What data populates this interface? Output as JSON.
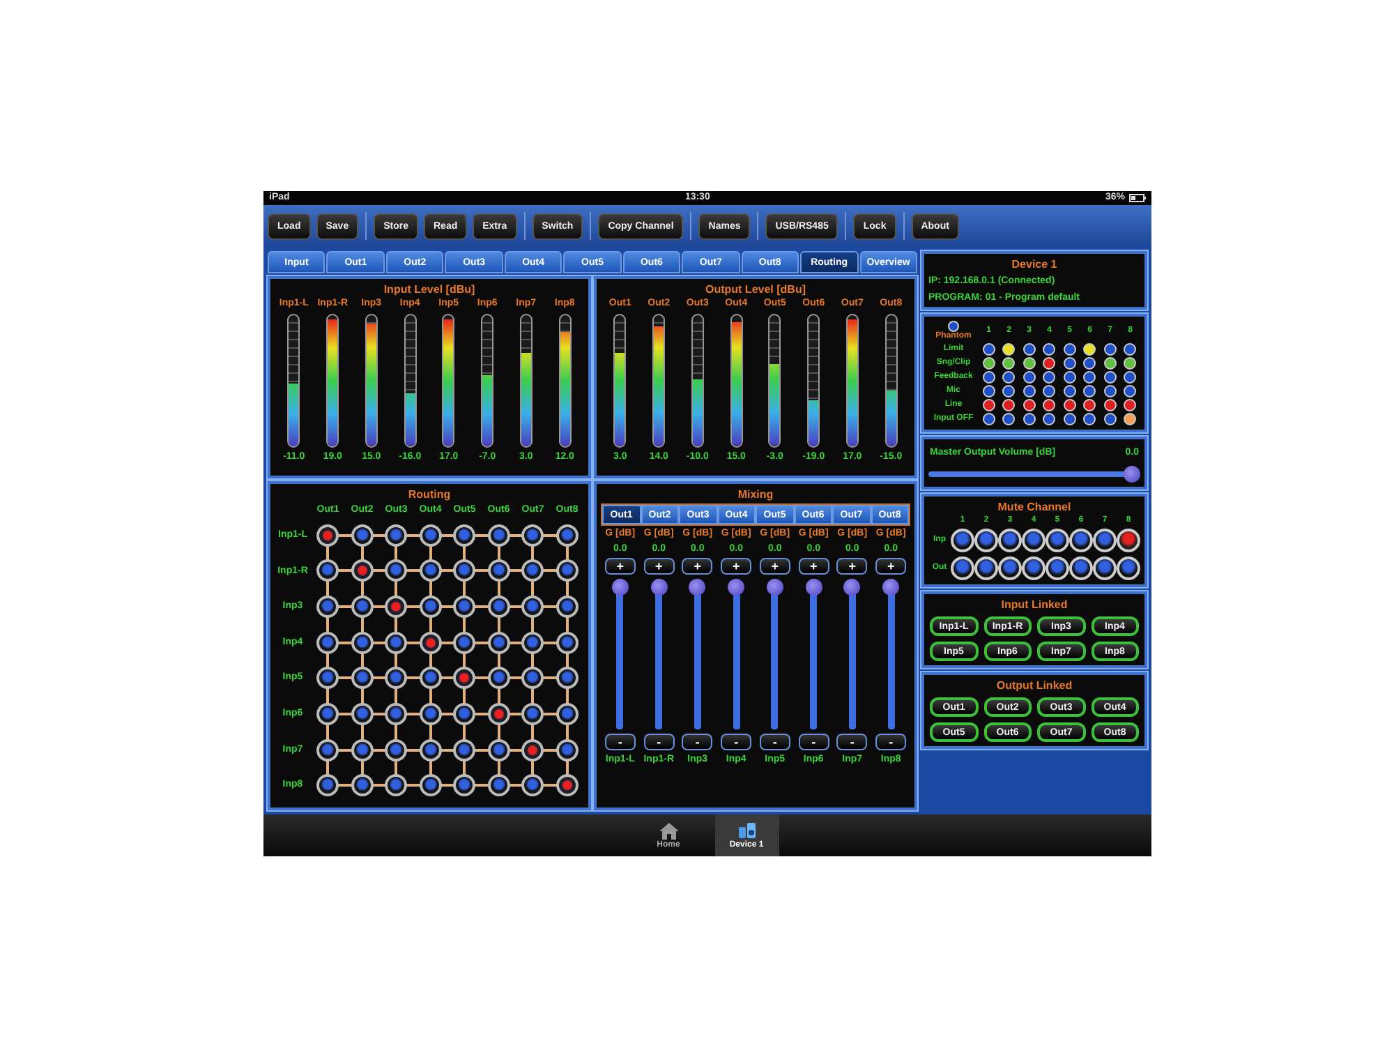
{
  "status_bar": {
    "device": "iPad",
    "time": "13:30",
    "battery": "36%"
  },
  "toolbar": [
    {
      "buttons": [
        "Load",
        "Save"
      ]
    },
    {
      "buttons": [
        "Store",
        "Read",
        "Extra"
      ]
    },
    {
      "buttons": [
        "Switch"
      ]
    },
    {
      "buttons": [
        "Copy Channel"
      ]
    },
    {
      "buttons": [
        "Names"
      ]
    },
    {
      "buttons": [
        "USB/RS485"
      ]
    },
    {
      "buttons": [
        "Lock"
      ]
    },
    {
      "buttons": [
        "About"
      ]
    }
  ],
  "tabs": [
    {
      "label": "Input",
      "selected": false
    },
    {
      "label": "Out1",
      "selected": false
    },
    {
      "label": "Out2",
      "selected": false
    },
    {
      "label": "Out3",
      "selected": false
    },
    {
      "label": "Out4",
      "selected": false
    },
    {
      "label": "Out5",
      "selected": false
    },
    {
      "label": "Out6",
      "selected": false
    },
    {
      "label": "Out7",
      "selected": false
    },
    {
      "label": "Out8",
      "selected": false
    },
    {
      "label": "Routing",
      "selected": true
    },
    {
      "label": "Overview",
      "selected": false
    }
  ],
  "input_level": {
    "title": "Input Level [dBu]",
    "meters": [
      {
        "label": "Inp1-L",
        "level": 0.48,
        "reading": "-11.0"
      },
      {
        "label": "Inp1-R",
        "level": 0.97,
        "reading": "19.0"
      },
      {
        "label": "Inp3",
        "level": 0.93,
        "reading": "15.0"
      },
      {
        "label": "Inp4",
        "level": 0.4,
        "reading": "-16.0"
      },
      {
        "label": "Inp5",
        "level": 0.97,
        "reading": "17.0"
      },
      {
        "label": "Inp6",
        "level": 0.54,
        "reading": "-7.0"
      },
      {
        "label": "Inp7",
        "level": 0.71,
        "reading": "3.0"
      },
      {
        "label": "Inp8",
        "level": 0.87,
        "reading": "12.0"
      }
    ]
  },
  "output_level": {
    "title": "Output Level [dBu]",
    "meters": [
      {
        "label": "Out1",
        "level": 0.71,
        "reading": "3.0"
      },
      {
        "label": "Out2",
        "level": 0.91,
        "reading": "14.0"
      },
      {
        "label": "Out3",
        "level": 0.51,
        "reading": "-10.0"
      },
      {
        "label": "Out4",
        "level": 0.94,
        "reading": "15.0"
      },
      {
        "label": "Out5",
        "level": 0.62,
        "reading": "-3.0"
      },
      {
        "label": "Out6",
        "level": 0.35,
        "reading": "-19.0"
      },
      {
        "label": "Out7",
        "level": 0.97,
        "reading": "17.0"
      },
      {
        "label": "Out8",
        "level": 0.42,
        "reading": "-15.0"
      }
    ]
  },
  "routing": {
    "title": "Routing",
    "columns": [
      "Out1",
      "Out2",
      "Out3",
      "Out4",
      "Out5",
      "Out6",
      "Out7",
      "Out8"
    ],
    "rows": [
      {
        "label": "Inp1-L",
        "nodes": [
          {
            "selected": true
          },
          {
            "selected": false
          },
          {
            "selected": false
          },
          {
            "selected": false
          },
          {
            "selected": false
          },
          {
            "selected": false
          },
          {
            "selected": false
          },
          {
            "selected": false
          }
        ]
      },
      {
        "label": "Inp1-R",
        "nodes": [
          {
            "selected": false
          },
          {
            "selected": true
          },
          {
            "selected": false
          },
          {
            "selected": false
          },
          {
            "selected": false
          },
          {
            "selected": false
          },
          {
            "selected": false
          },
          {
            "selected": false
          }
        ]
      },
      {
        "label": "Inp3",
        "nodes": [
          {
            "selected": false
          },
          {
            "selected": false
          },
          {
            "selected": true
          },
          {
            "selected": false
          },
          {
            "selected": false
          },
          {
            "selected": false
          },
          {
            "selected": false
          },
          {
            "selected": false
          }
        ]
      },
      {
        "label": "Inp4",
        "nodes": [
          {
            "selected": false
          },
          {
            "selected": false
          },
          {
            "selected": false
          },
          {
            "selected": true
          },
          {
            "selected": false
          },
          {
            "selected": false
          },
          {
            "selected": false
          },
          {
            "selected": false
          }
        ]
      },
      {
        "label": "Inp5",
        "nodes": [
          {
            "selected": false
          },
          {
            "selected": false
          },
          {
            "selected": false
          },
          {
            "selected": false
          },
          {
            "selected": true
          },
          {
            "selected": false
          },
          {
            "selected": false
          },
          {
            "selected": false
          }
        ]
      },
      {
        "label": "Inp6",
        "nodes": [
          {
            "selected": false
          },
          {
            "selected": false
          },
          {
            "selected": false
          },
          {
            "selected": false
          },
          {
            "selected": false
          },
          {
            "selected": true
          },
          {
            "selected": false
          },
          {
            "selected": false
          }
        ]
      },
      {
        "label": "Inp7",
        "nodes": [
          {
            "selected": false
          },
          {
            "selected": false
          },
          {
            "selected": false
          },
          {
            "selected": false
          },
          {
            "selected": false
          },
          {
            "selected": false
          },
          {
            "selected": true
          },
          {
            "selected": false
          }
        ]
      },
      {
        "label": "Inp8",
        "nodes": [
          {
            "selected": false
          },
          {
            "selected": false
          },
          {
            "selected": false
          },
          {
            "selected": false
          },
          {
            "selected": false
          },
          {
            "selected": false
          },
          {
            "selected": false
          },
          {
            "selected": true
          }
        ]
      }
    ]
  },
  "mixing": {
    "title": "Mixing",
    "tabs": [
      {
        "label": "Out1",
        "selected": true
      },
      {
        "label": "Out2",
        "selected": false
      },
      {
        "label": "Out3",
        "selected": false
      },
      {
        "label": "Out4",
        "selected": false
      },
      {
        "label": "Out5",
        "selected": false
      },
      {
        "label": "Out6",
        "selected": false
      },
      {
        "label": "Out7",
        "selected": false
      },
      {
        "label": "Out8",
        "selected": false
      }
    ],
    "channels": [
      {
        "gain_label": "G [dB]",
        "value": "0.0",
        "plus": "+",
        "minus": "-",
        "level": 1,
        "input": "Inp1-L"
      },
      {
        "gain_label": "G [dB]",
        "value": "0.0",
        "plus": "+",
        "minus": "-",
        "level": 1,
        "input": "Inp1-R"
      },
      {
        "gain_label": "G [dB]",
        "value": "0.0",
        "plus": "+",
        "minus": "-",
        "level": 1,
        "input": "Inp3"
      },
      {
        "gain_label": "G [dB]",
        "value": "0.0",
        "plus": "+",
        "minus": "-",
        "level": 1,
        "input": "Inp4"
      },
      {
        "gain_label": "G [dB]",
        "value": "0.0",
        "plus": "+",
        "minus": "-",
        "level": 1,
        "input": "Inp5"
      },
      {
        "gain_label": "G [dB]",
        "value": "0.0",
        "plus": "+",
        "minus": "-",
        "level": 1,
        "input": "Inp6"
      },
      {
        "gain_label": "G [dB]",
        "value": "0.0",
        "plus": "+",
        "minus": "-",
        "level": 1,
        "input": "Inp7"
      },
      {
        "gain_label": "G [dB]",
        "value": "0.0",
        "plus": "+",
        "minus": "-",
        "level": 1,
        "input": "Inp8"
      }
    ]
  },
  "device": {
    "name": "Device 1",
    "ip": "IP: 192.168.0.1 (Connected)",
    "program": "PROGRAM: 01 - Program default"
  },
  "status_matrix": {
    "header_label": "Phantom",
    "columns": [
      "1",
      "2",
      "3",
      "4",
      "5",
      "6",
      "7",
      "8"
    ],
    "rows": [
      {
        "label": "Limit",
        "dots": [
          {
            "color": "#2050c8"
          },
          {
            "color": "#e8e020"
          },
          {
            "color": "#2050c8"
          },
          {
            "color": "#2050c8"
          },
          {
            "color": "#2050c8"
          },
          {
            "color": "#e8e020"
          },
          {
            "color": "#2050c8"
          },
          {
            "color": "#2050c8"
          }
        ]
      },
      {
        "label": "Sng/Clip",
        "dots": [
          {
            "color": "#60c040"
          },
          {
            "color": "#60c040"
          },
          {
            "color": "#60c040"
          },
          {
            "color": "#e02020"
          },
          {
            "color": "#2050c8"
          },
          {
            "color": "#2050c8"
          },
          {
            "color": "#60c040"
          },
          {
            "color": "#60c040"
          }
        ]
      },
      {
        "label": "Feedback",
        "dots": [
          {
            "color": "#2050c8"
          },
          {
            "color": "#2050c8"
          },
          {
            "color": "#2050c8"
          },
          {
            "color": "#2050c8"
          },
          {
            "color": "#2050c8"
          },
          {
            "color": "#2050c8"
          },
          {
            "color": "#2050c8"
          },
          {
            "color": "#2050c8"
          }
        ]
      },
      {
        "label": "Mic",
        "dots": [
          {
            "color": "#2050c8"
          },
          {
            "color": "#2050c8"
          },
          {
            "color": "#2050c8"
          },
          {
            "color": "#2050c8"
          },
          {
            "color": "#2050c8"
          },
          {
            "color": "#2050c8"
          },
          {
            "color": "#2050c8"
          },
          {
            "color": "#2050c8"
          }
        ]
      },
      {
        "label": "Line",
        "dots": [
          {
            "color": "#e02020"
          },
          {
            "color": "#e02020"
          },
          {
            "color": "#e02020"
          },
          {
            "color": "#e02020"
          },
          {
            "color": "#e02020"
          },
          {
            "color": "#e02020"
          },
          {
            "color": "#e02020"
          },
          {
            "color": "#e02020"
          }
        ]
      },
      {
        "label": "Input OFF",
        "dots": [
          {
            "color": "#2050c8"
          },
          {
            "color": "#2050c8"
          },
          {
            "color": "#2050c8"
          },
          {
            "color": "#2050c8"
          },
          {
            "color": "#2050c8"
          },
          {
            "color": "#2050c8"
          },
          {
            "color": "#2050c8"
          },
          {
            "color": "#f0a050"
          }
        ]
      }
    ]
  },
  "master_volume": {
    "label": "Master Output Volume [dB]",
    "reading": "0.0",
    "level": 1
  },
  "mute_channel": {
    "title": "Mute Channel",
    "columns": [
      "1",
      "2",
      "3",
      "4",
      "5",
      "6",
      "7",
      "8"
    ],
    "rows": [
      {
        "label": "Inp",
        "buttons": [
          {
            "muted": false
          },
          {
            "muted": false
          },
          {
            "muted": false
          },
          {
            "muted": false
          },
          {
            "muted": false
          },
          {
            "muted": false
          },
          {
            "muted": false
          },
          {
            "muted": true
          }
        ]
      },
      {
        "label": "Out",
        "buttons": [
          {
            "muted": false
          },
          {
            "muted": false
          },
          {
            "muted": false
          },
          {
            "muted": false
          },
          {
            "muted": false
          },
          {
            "muted": false
          },
          {
            "muted": false
          },
          {
            "muted": false
          }
        ]
      }
    ]
  },
  "input_linked": {
    "title": "Input Linked",
    "buttons": [
      "Inp1-L",
      "Inp1-R",
      "Inp3",
      "Inp4",
      "Inp5",
      "Inp6",
      "Inp7",
      "Inp8"
    ]
  },
  "output_linked": {
    "title": "Output Linked",
    "buttons": [
      "Out1",
      "Out2",
      "Out3",
      "Out4",
      "Out5",
      "Out6",
      "Out7",
      "Out8"
    ]
  },
  "bottom_tabs": [
    {
      "label": "Home",
      "kind": "home",
      "selected": false
    },
    {
      "label": "Device 1",
      "kind": "device",
      "selected": true
    }
  ]
}
